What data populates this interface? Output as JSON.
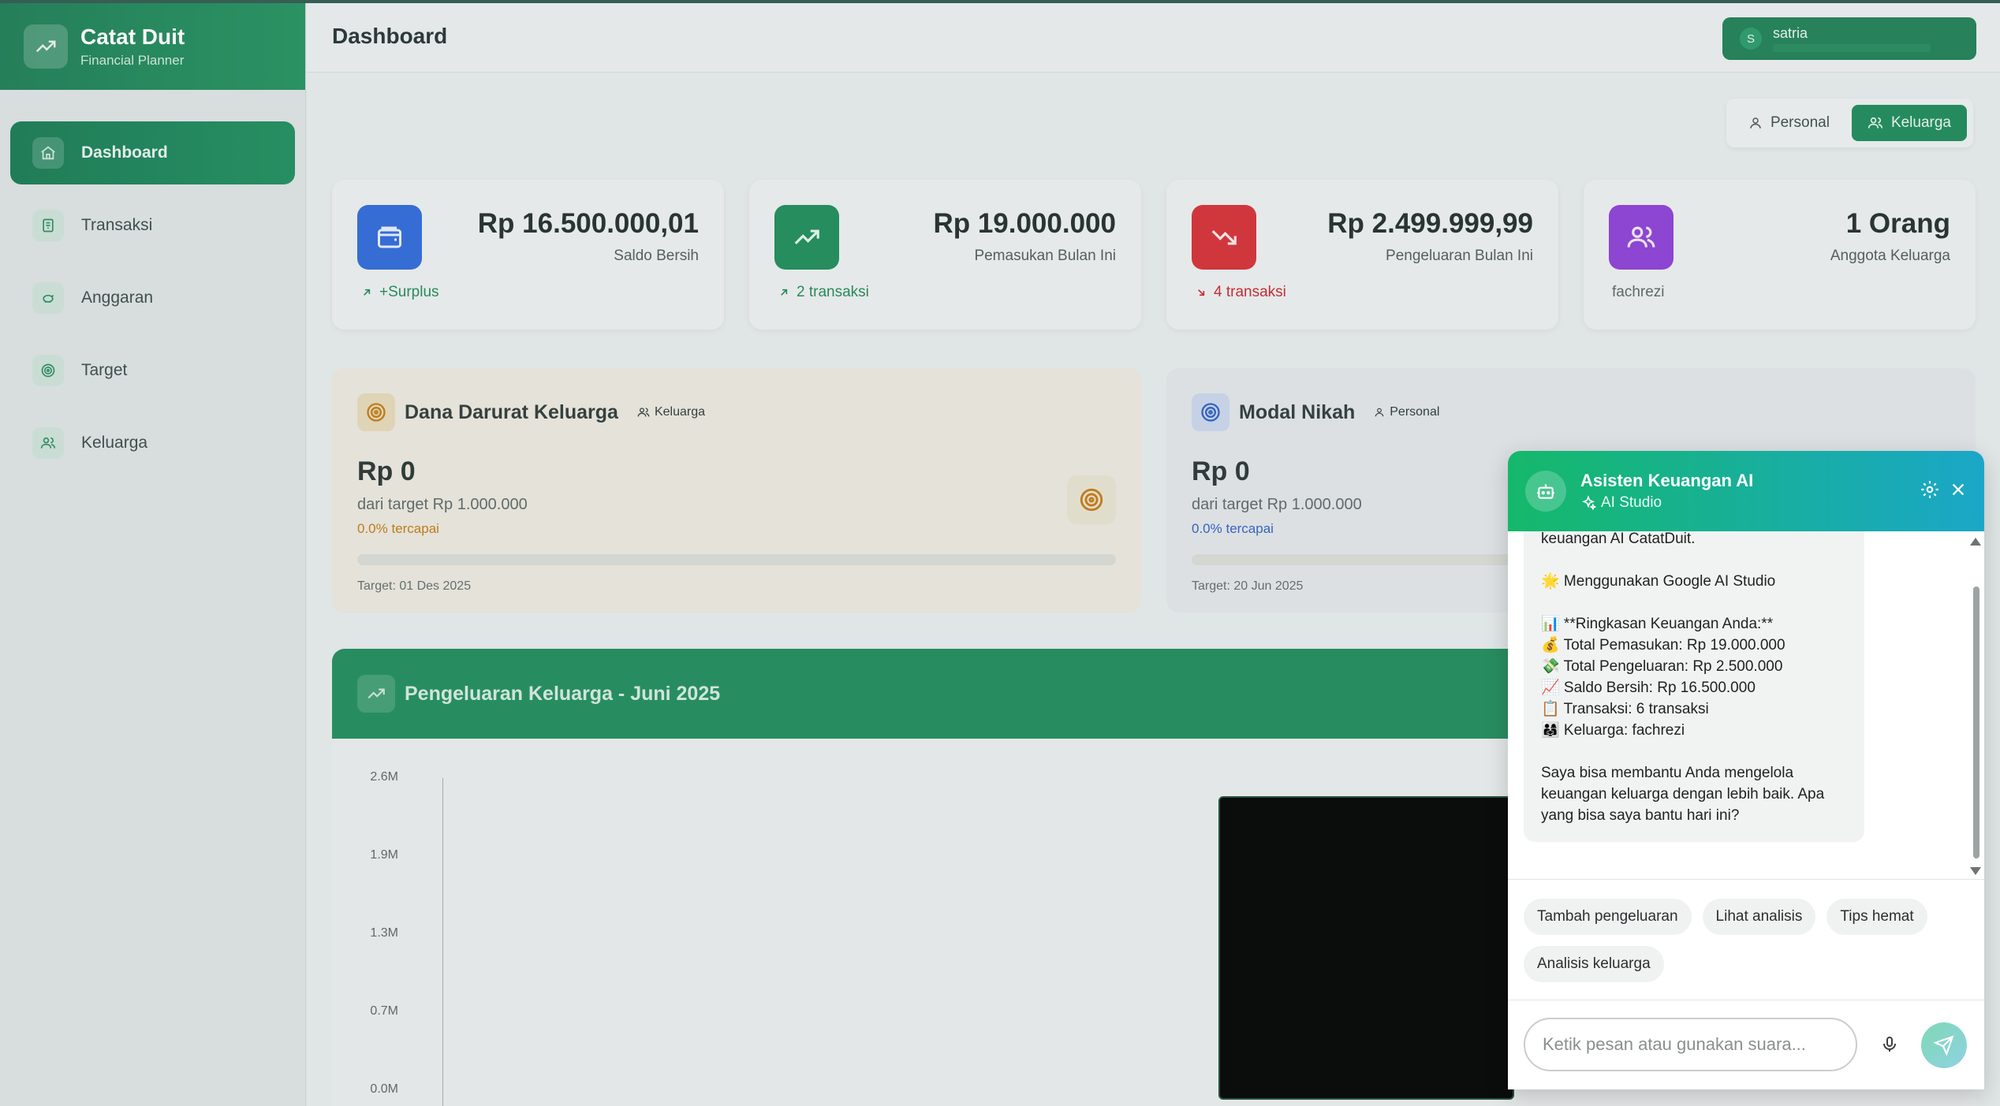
{
  "app": {
    "title": "Catat Duit",
    "subtitle": "Financial Planner"
  },
  "sidebar": {
    "items": [
      {
        "label": "Dashboard",
        "icon": "home-icon",
        "active": true
      },
      {
        "label": "Transaksi",
        "icon": "receipt-icon"
      },
      {
        "label": "Anggaran",
        "icon": "piggy-bank-icon"
      },
      {
        "label": "Target",
        "icon": "target-icon"
      },
      {
        "label": "Keluarga",
        "icon": "users-icon"
      }
    ]
  },
  "header": {
    "title": "Dashboard",
    "user": {
      "initial": "S",
      "name": "satria"
    }
  },
  "mode_toggle": {
    "personal": "Personal",
    "family": "Keluarga",
    "active": "Keluarga"
  },
  "stats": [
    {
      "value": "Rp 16.500.000,01",
      "label": "Saldo Bersih",
      "foot": "+Surplus",
      "icon": "wallet-icon",
      "color": "#2f6ad9",
      "foot_color": "#1f8a57"
    },
    {
      "value": "Rp 19.000.000",
      "label": "Pemasukan Bulan Ini",
      "foot": "2 transaksi",
      "icon": "trending-up-icon",
      "color": "#1d8c5a",
      "foot_color": "#1f8a57"
    },
    {
      "value": "Rp 2.499.999,99",
      "label": "Pengeluaran Bulan Ini",
      "foot": "4 transaksi",
      "icon": "trending-down-icon",
      "color": "#d52f36",
      "foot_color": "#c8262e"
    },
    {
      "value": "1 Orang",
      "label": "Anggota Keluarga",
      "foot": "fachrezi",
      "icon": "users-icon",
      "color": "#8d3fd6",
      "foot_color": "#5b6563"
    }
  ],
  "goals": [
    {
      "title": "Dana Darurat Keluarga",
      "tag": "Keluarga",
      "amount": "Rp 0",
      "target": "dari target Rp 1.000.000",
      "percent": "0.0% tercapai",
      "progress": 0,
      "date": "Target: 01 Des 2025",
      "accent": "#c47a12"
    },
    {
      "title": "Modal Nikah",
      "tag": "Personal",
      "amount": "Rp 0",
      "target": "dari target Rp 1.000.000",
      "percent": "0.0% tercapai",
      "progress": 0,
      "date": "Target: 20 Jun 2025",
      "accent": "#2f5fc4"
    }
  ],
  "chart": {
    "title": "Pengeluaran Keluarga - Juni 2025",
    "y_ticks": [
      "2.6M",
      "1.9M",
      "1.3M",
      "0.7M",
      "0.0M"
    ]
  },
  "chat": {
    "title": "Asisten Keuangan AI",
    "subtitle": "AI Studio",
    "message_lines": [
      "keuangan AI CatatDuit.",
      "",
      "🌟 Menggunakan Google AI Studio",
      "",
      "📊 **Ringkasan Keuangan Anda:**",
      "💰 Total Pemasukan: Rp 19.000.000",
      "💸 Total Pengeluaran: Rp 2.500.000",
      "📈 Saldo Bersih: Rp 16.500.000",
      "📋 Transaksi: 6 transaksi",
      "👨‍👩‍👧 Keluarga: fachrezi",
      "",
      "Saya bisa membantu Anda mengelola",
      "keuangan keluarga dengan lebih baik. Apa",
      "yang bisa saya bantu hari ini?"
    ],
    "quick_actions": [
      "Tambah pengeluaran",
      "Lihat analisis",
      "Tips hemat",
      "Analisis keluarga"
    ],
    "input_placeholder": "Ketik pesan atau gunakan suara..."
  }
}
